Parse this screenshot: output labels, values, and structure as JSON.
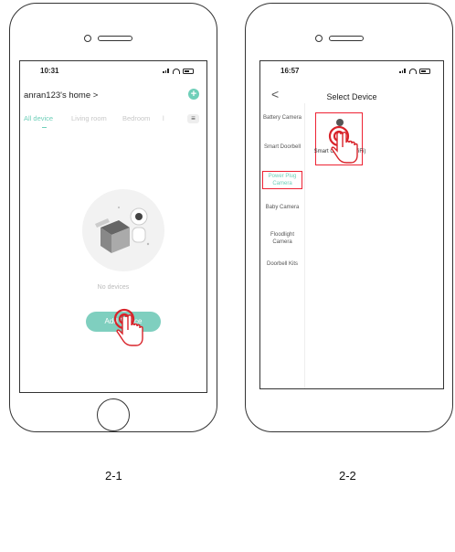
{
  "screen1": {
    "time": "10:31",
    "home_title": "anran123's home >",
    "add_icon": "+",
    "tabs": [
      "All device",
      "Living room",
      "Bedroom",
      "l"
    ],
    "menu_icon": "≡",
    "empty_text": "No devices",
    "add_button": "Add Device",
    "caption": "2-1"
  },
  "screen2": {
    "time": "16:57",
    "back_icon": "<",
    "title": "Select Device",
    "categories": [
      "Battery Camera",
      "Smart Doorbell",
      "Power Plug Camera",
      "Baby Camera",
      "Floodlight Camera",
      "Doorbell Kits"
    ],
    "device_label": "Smart Camera (WiFi)",
    "caption": "2-2"
  },
  "colors": {
    "accent": "#6fcfb9",
    "highlight": "#e22233"
  }
}
